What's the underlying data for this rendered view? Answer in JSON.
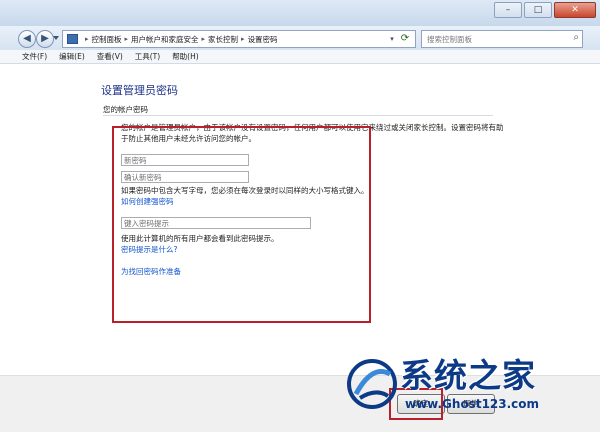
{
  "window": {
    "controls": {
      "minimize": "–",
      "maximize": "□",
      "close": "✕"
    }
  },
  "addressbar": {
    "back": "◀",
    "forward": "▶",
    "breadcrumbs": [
      "控制面板",
      "用户帐户和家庭安全",
      "家长控制",
      "设置密码"
    ],
    "search_placeholder": "搜索控制面板"
  },
  "menu": {
    "items": [
      "文件(F)",
      "编辑(E)",
      "查看(V)",
      "工具(T)",
      "帮助(H)"
    ]
  },
  "main": {
    "title": "设置管理员密码",
    "section_label": "您的帐户密码",
    "description": "您的帐户是管理员帐户，由于该帐户没有设置密码，任何用户都可以使用它来绕过或关闭家长控制。设置密码将有助于防止其他用户未经允许访问您的帐户。",
    "new_password_placeholder": "新密码",
    "confirm_password_placeholder": "确认新密码",
    "case_note": "如果密码中包含大写字母，您必须在每次登录时以同样的大小写格式键入。",
    "strong_password_link": "如何创建强密码",
    "hint_placeholder": "键入密码提示",
    "hint_note": "使用此计算机的所有用户都会看到此密码提示。",
    "hint_help_link": "密码提示是什么?",
    "reset_disk_link": "为找回密码作准备"
  },
  "footer": {
    "ok_label": "确定",
    "cancel_label": "取消"
  },
  "watermark": {
    "name": "系统之家",
    "url": "www.Ghost123.com"
  },
  "colors": {
    "heading": "#1e3287",
    "link": "#1155cc",
    "highlight_red": "#b8212a",
    "watermark": "#0c3a86"
  },
  "icons": [
    "back-icon",
    "forward-icon",
    "control-panel-icon",
    "refresh-icon",
    "search-icon"
  ]
}
